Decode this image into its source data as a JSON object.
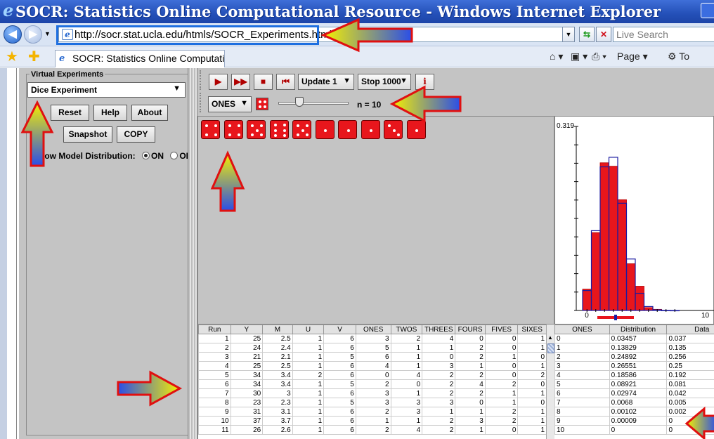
{
  "window": {
    "title": "SOCR: Statistics Online Computational Resource - Windows Internet Explorer"
  },
  "browser": {
    "url": "http://socr.stat.ucla.edu/htmls/SOCR_Experiments.html",
    "search_placeholder": "Live Search",
    "tab_title": "SOCR: Statistics Online Computatio...",
    "commands": {
      "page": "Page ▾",
      "tools": "To"
    }
  },
  "sidebar": {
    "group_label": "Virtual Experiments",
    "experiment": "Dice Experiment",
    "buttons": {
      "reset": "Reset",
      "help": "Help",
      "about": "About",
      "snapshot": "Snapshot",
      "copy": "COPY"
    },
    "show_model": {
      "label": "Show Model Distribution:",
      "on": "ON",
      "off": "OFF",
      "selected": "ON"
    }
  },
  "toolbar": {
    "update": "Update 1",
    "stop": "Stop 1000",
    "info": "i",
    "variable": "ONES",
    "n_label": "n = 10",
    "n": 10
  },
  "dice": [
    4,
    4,
    5,
    6,
    5,
    1,
    1,
    1,
    3,
    1
  ],
  "table": {
    "columns": [
      "Run",
      "Y",
      "M",
      "U",
      "V",
      "ONES",
      "TWOS",
      "THREES",
      "FOURS",
      "FIVES",
      "SIXES"
    ],
    "rows": [
      [
        "1",
        "25",
        "2.5",
        "1",
        "6",
        "3",
        "2",
        "4",
        "0",
        "0",
        "1"
      ],
      [
        "2",
        "24",
        "2.4",
        "1",
        "6",
        "5",
        "1",
        "1",
        "2",
        "0",
        "1"
      ],
      [
        "3",
        "21",
        "2.1",
        "1",
        "5",
        "6",
        "1",
        "0",
        "2",
        "1",
        "0"
      ],
      [
        "4",
        "25",
        "2.5",
        "1",
        "6",
        "4",
        "1",
        "3",
        "1",
        "0",
        "1"
      ],
      [
        "5",
        "34",
        "3.4",
        "2",
        "6",
        "0",
        "4",
        "2",
        "2",
        "0",
        "2"
      ],
      [
        "6",
        "34",
        "3.4",
        "1",
        "5",
        "2",
        "0",
        "2",
        "4",
        "2",
        "0"
      ],
      [
        "7",
        "30",
        "3",
        "1",
        "6",
        "3",
        "1",
        "2",
        "2",
        "1",
        "1"
      ],
      [
        "8",
        "23",
        "2.3",
        "1",
        "5",
        "3",
        "3",
        "3",
        "0",
        "1",
        "0"
      ],
      [
        "9",
        "31",
        "3.1",
        "1",
        "6",
        "2",
        "3",
        "1",
        "1",
        "2",
        "1"
      ],
      [
        "10",
        "37",
        "3.7",
        "1",
        "6",
        "1",
        "1",
        "2",
        "3",
        "2",
        "1"
      ],
      [
        "11",
        "26",
        "2.6",
        "1",
        "6",
        "2",
        "4",
        "2",
        "1",
        "0",
        "1"
      ]
    ]
  },
  "dist_table": {
    "columns": [
      "ONES",
      "Distribution",
      "Data"
    ],
    "rows": [
      [
        "0",
        "0.03457",
        "0.037"
      ],
      [
        "1",
        "0.13829",
        "0.135"
      ],
      [
        "2",
        "0.24892",
        "0.256"
      ],
      [
        "3",
        "0.26551",
        "0.25"
      ],
      [
        "4",
        "0.18586",
        "0.192"
      ],
      [
        "5",
        "0.08921",
        "0.081"
      ],
      [
        "6",
        "0.02974",
        "0.042"
      ],
      [
        "7",
        "0.0068",
        "0.005"
      ],
      [
        "8",
        "0.00102",
        "0.002"
      ],
      [
        "9",
        "0.00009",
        "0"
      ],
      [
        "10",
        "0",
        "0"
      ]
    ]
  },
  "chart_data": {
    "type": "bar",
    "categories": [
      "0",
      "1",
      "2",
      "3",
      "4",
      "5",
      "6",
      "7",
      "8",
      "9",
      "10"
    ],
    "series": [
      {
        "name": "Data",
        "values": [
          0.037,
          0.135,
          0.256,
          0.25,
          0.192,
          0.081,
          0.042,
          0.005,
          0.002,
          0,
          0
        ]
      },
      {
        "name": "Distribution",
        "values": [
          0.03457,
          0.13829,
          0.24892,
          0.26551,
          0.18586,
          0.08921,
          0.02974,
          0.0068,
          0.00102,
          9e-05,
          0
        ]
      }
    ],
    "ymax_label": "0.319",
    "x_ticks": [
      "0",
      "10"
    ],
    "ylim": [
      0,
      0.319
    ],
    "colors": {
      "data": "#e8161c",
      "distribution": "#1a1aa0"
    }
  }
}
